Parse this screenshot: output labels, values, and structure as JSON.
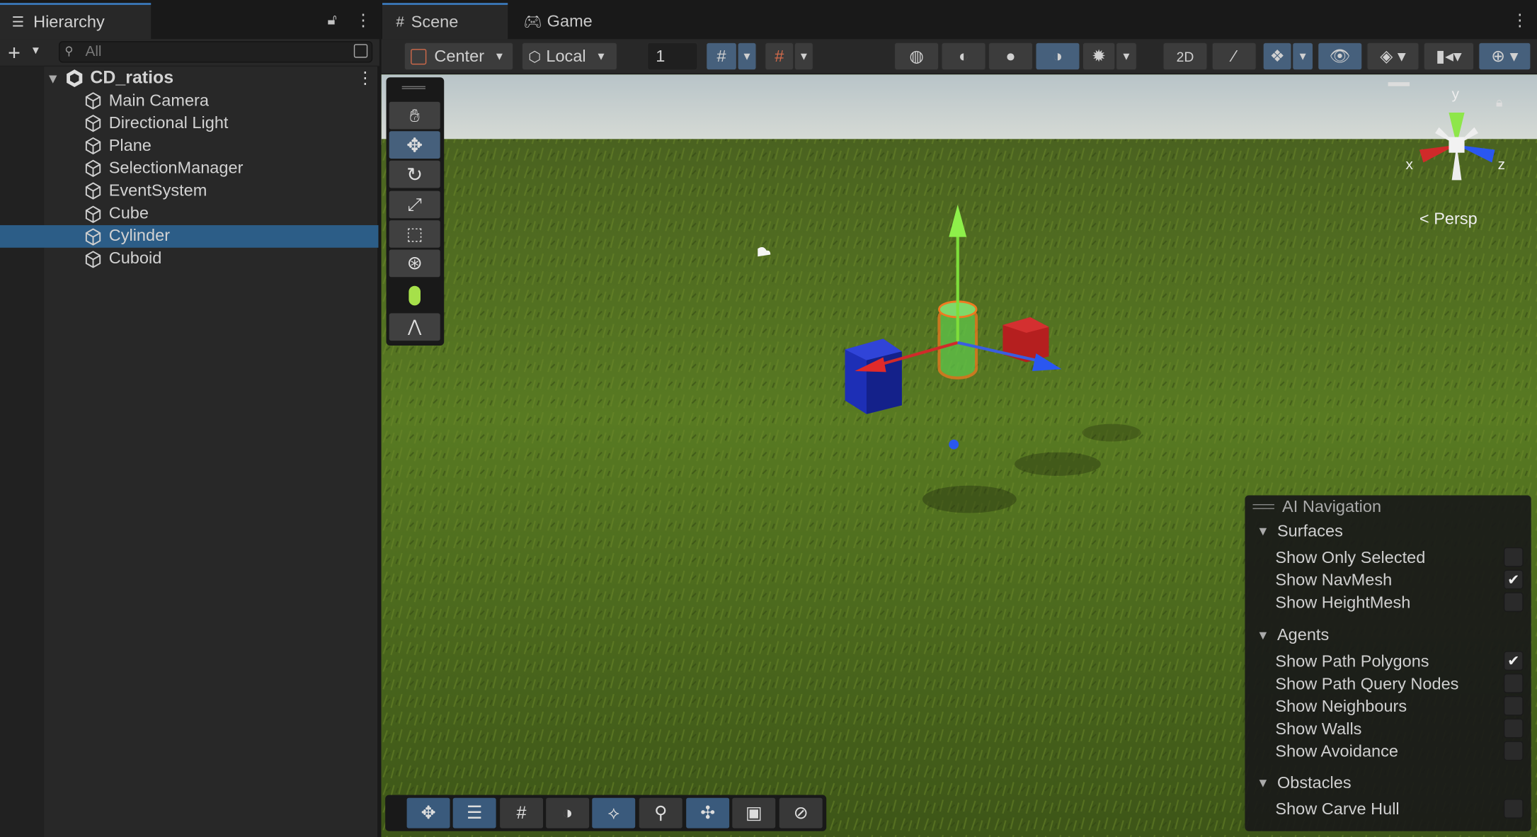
{
  "hierarchy": {
    "tab_label": "Hierarchy",
    "search_placeholder": "All",
    "root": "CD_ratios",
    "items": [
      "Main Camera",
      "Directional Light",
      "Plane",
      "SelectionManager",
      "EventSystem",
      "Cube",
      "Cylinder",
      "Cuboid"
    ],
    "selected": "Cylinder"
  },
  "tabs": {
    "scene": "Scene",
    "game": "Game"
  },
  "toolbar": {
    "pivot": "Center",
    "space": "Local",
    "grid_snap": "1"
  },
  "scene": {
    "persp_label": "Persp",
    "axis_x": "x",
    "axis_y": "y",
    "axis_z": "z"
  },
  "ai_navigation": {
    "title": "AI Navigation",
    "surfaces": {
      "label": "Surfaces",
      "items": [
        {
          "label": "Show Only Selected",
          "checked": false
        },
        {
          "label": "Show NavMesh",
          "checked": true
        },
        {
          "label": "Show HeightMesh",
          "checked": false
        }
      ]
    },
    "agents": {
      "label": "Agents",
      "items": [
        {
          "label": "Show Path Polygons",
          "checked": true
        },
        {
          "label": "Show Path Query Nodes",
          "checked": false
        },
        {
          "label": "Show Neighbours",
          "checked": false
        },
        {
          "label": "Show Walls",
          "checked": false
        },
        {
          "label": "Show Avoidance",
          "checked": false
        }
      ]
    },
    "obstacles": {
      "label": "Obstacles",
      "items": [
        {
          "label": "Show Carve Hull",
          "checked": false
        }
      ]
    }
  },
  "colors": {
    "accent": "#3a79bb",
    "selected_row": "#2c5d87",
    "panel": "#282828"
  }
}
